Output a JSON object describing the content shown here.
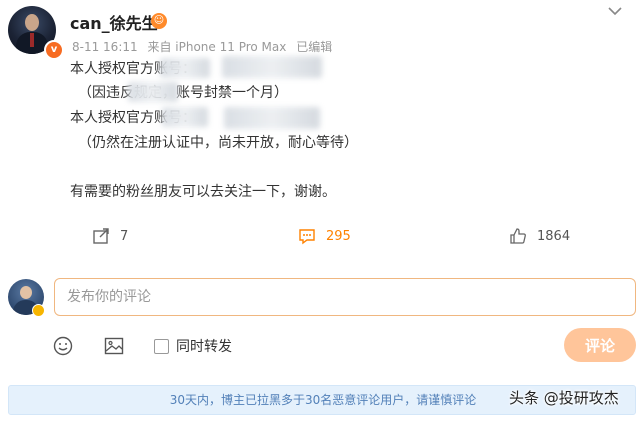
{
  "post": {
    "author": "can_徐先生",
    "meta": {
      "date": "8-11 16:11",
      "source": "来自 iPhone 11 Pro Max",
      "edited": "已编辑"
    },
    "lines": [
      "本人授权官方账号：",
      "（因违反规定，账号封禁一个月）",
      "本人授权官方账号：",
      "（仍然在注册认证中，尚未开放，耐心等待）",
      "有需要的粉丝朋友可以去关注一下，谢谢。"
    ]
  },
  "actions": {
    "repost_count": "7",
    "comment_count": "295",
    "like_count": "1864"
  },
  "composer": {
    "placeholder": "发布你的评论",
    "repost_label": "同时转发",
    "submit_label": "评论"
  },
  "notice": {
    "text": "30天内，博主已拉黑多于30名恶意评论用户，请谨慎评论"
  },
  "watermark": "头条 @投研攻杰",
  "colors": {
    "accent": "#ff8200",
    "submit_disabled": "#ffc59a",
    "notice_bg": "#e5f1fc",
    "notice_text": "#5280b8"
  }
}
